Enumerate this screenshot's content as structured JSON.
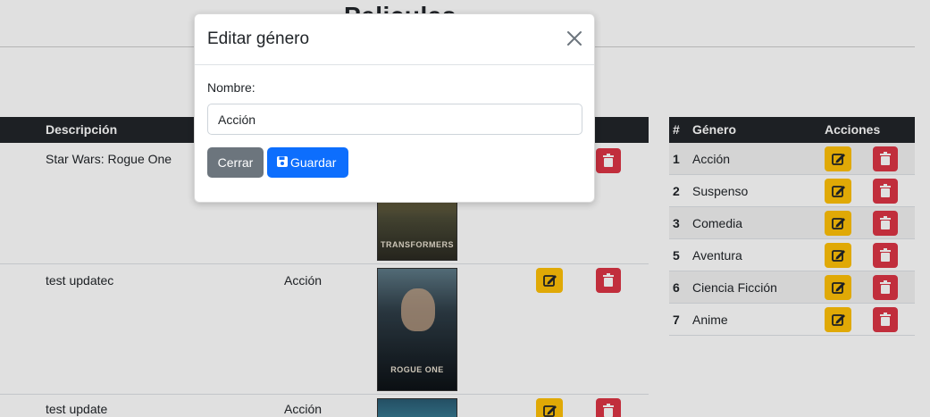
{
  "page": {
    "title": "Peliculas"
  },
  "movies_table": {
    "headers": [
      "Descripción"
    ],
    "rows": [
      {
        "description": "Star Wars: Rogue One",
        "genre": "",
        "poster": "transformers-poster",
        "poster_text": "TRANSFORMERS"
      },
      {
        "description": "test updatec",
        "genre": "Acción",
        "poster": "rogue-one-poster",
        "poster_text": "ROGUE ONE"
      },
      {
        "description": "test update",
        "genre": "Acción",
        "poster": "third-poster",
        "poster_text": ""
      }
    ]
  },
  "genre_table": {
    "headers": {
      "num": "#",
      "name": "Género",
      "actions": "Acciones"
    },
    "rows": [
      {
        "num": "1",
        "name": "Acción"
      },
      {
        "num": "2",
        "name": "Suspenso"
      },
      {
        "num": "3",
        "name": "Comedia"
      },
      {
        "num": "5",
        "name": "Aventura"
      },
      {
        "num": "6",
        "name": "Ciencia Ficción"
      },
      {
        "num": "7",
        "name": "Anime"
      }
    ]
  },
  "modal": {
    "title": "Editar género",
    "field_label": "Nombre:",
    "field_value": "Acción",
    "close_label": "Cerrar",
    "save_label": "Guardar"
  },
  "icons": {
    "edit": "edit-icon",
    "delete": "trash-icon",
    "close": "close-icon",
    "save": "floppy-disk-icon"
  },
  "colors": {
    "warning": "#ffc107",
    "danger": "#dc3545",
    "primary": "#0d6efd",
    "secondary": "#6c757d",
    "dark": "#212529"
  }
}
